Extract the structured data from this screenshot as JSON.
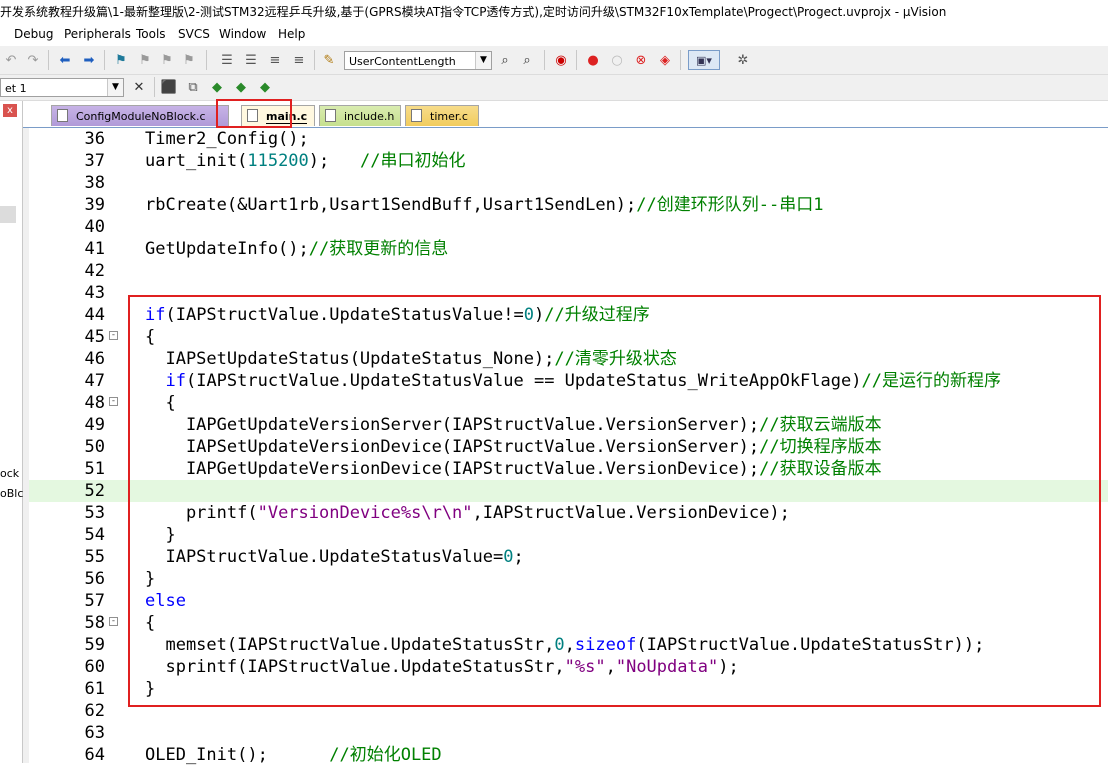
{
  "window": {
    "title": "开发系统教程升级篇\\1-最新整理版\\2-测试STM32远程乒乓升级,基于(GPRS模块AT指令TCP透传方式),定时访问升级\\STM32F10xTemplate\\Progect\\Progect.uvprojx - µVision"
  },
  "menu": [
    "Debug",
    "Peripherals",
    "Tools",
    "SVCS",
    "Window",
    "Help"
  ],
  "toolbar": {
    "find_combo_value": "UserContentLength",
    "target_combo_value": "et 1"
  },
  "left_panel": {
    "close_label": "x",
    "fragments": [
      "ock",
      "oBlc"
    ]
  },
  "tabs": [
    {
      "label": "ConfigModuleNoBlock.c",
      "active": false
    },
    {
      "label": "main.c",
      "active": true
    },
    {
      "label": "include.h",
      "active": false
    },
    {
      "label": "timer.c",
      "active": false
    }
  ],
  "code_lines": [
    {
      "num": "36",
      "fold": "",
      "tokens": [
        [
          "",
          "Timer2_Config();"
        ]
      ]
    },
    {
      "num": "37",
      "fold": "",
      "tokens": [
        [
          "",
          "uart_init("
        ],
        [
          "n",
          "115200"
        ],
        [
          "",
          ");   "
        ],
        [
          "c",
          "//串口初始化"
        ]
      ]
    },
    {
      "num": "38",
      "fold": "",
      "tokens": []
    },
    {
      "num": "39",
      "fold": "",
      "tokens": [
        [
          "",
          "rbCreate(&Uart1rb,Usart1SendBuff,Usart1SendLen);"
        ],
        [
          "c",
          "//创建环形队列--串口1"
        ]
      ]
    },
    {
      "num": "40",
      "fold": "",
      "tokens": []
    },
    {
      "num": "41",
      "fold": "",
      "tokens": [
        [
          "",
          "GetUpdateInfo();"
        ],
        [
          "c",
          "//获取更新的信息"
        ]
      ]
    },
    {
      "num": "42",
      "fold": "",
      "tokens": []
    },
    {
      "num": "43",
      "fold": "",
      "tokens": []
    },
    {
      "num": "44",
      "fold": "",
      "tokens": [
        [
          "k",
          "if"
        ],
        [
          "",
          "(IAPStructValue.UpdateStatusValue!="
        ],
        [
          "n",
          "0"
        ],
        [
          "",
          ")"
        ],
        [
          "c",
          "//升级过程序"
        ]
      ]
    },
    {
      "num": "45",
      "fold": "-",
      "tokens": [
        [
          "",
          "{"
        ]
      ]
    },
    {
      "num": "46",
      "fold": "",
      "tokens": [
        [
          "",
          "  IAPSetUpdateStatus(UpdateStatus_None);"
        ],
        [
          "c",
          "//清零升级状态"
        ]
      ]
    },
    {
      "num": "47",
      "fold": "",
      "tokens": [
        [
          "",
          "  "
        ],
        [
          "k",
          "if"
        ],
        [
          "",
          "(IAPStructValue.UpdateStatusValue == UpdateStatus_WriteAppOkFlage)"
        ],
        [
          "c",
          "//是运行的新程序"
        ]
      ]
    },
    {
      "num": "48",
      "fold": "-",
      "tokens": [
        [
          "",
          "  {"
        ]
      ]
    },
    {
      "num": "49",
      "fold": "",
      "tokens": [
        [
          "",
          "    IAPGetUpdateVersionServer(IAPStructValue.VersionServer);"
        ],
        [
          "c",
          "//获取云端版本"
        ]
      ]
    },
    {
      "num": "50",
      "fold": "",
      "tokens": [
        [
          "",
          "    IAPSetUpdateVersionDevice(IAPStructValue.VersionServer);"
        ],
        [
          "c",
          "//切换程序版本"
        ]
      ]
    },
    {
      "num": "51",
      "fold": "",
      "tokens": [
        [
          "",
          "    IAPGetUpdateVersionDevice(IAPStructValue.VersionDevice);"
        ],
        [
          "c",
          "//获取设备版本"
        ]
      ]
    },
    {
      "num": "52",
      "fold": "",
      "current": true,
      "tokens": []
    },
    {
      "num": "53",
      "fold": "",
      "tokens": [
        [
          "",
          "    printf("
        ],
        [
          "s",
          "\"VersionDevice%s\\r\\n\""
        ],
        [
          "",
          ",IAPStructValue.VersionDevice);"
        ]
      ]
    },
    {
      "num": "54",
      "fold": "",
      "tokens": [
        [
          "",
          "  }"
        ]
      ]
    },
    {
      "num": "55",
      "fold": "",
      "tokens": [
        [
          "",
          "  IAPStructValue.UpdateStatusValue="
        ],
        [
          "n",
          "0"
        ],
        [
          "",
          ";"
        ]
      ]
    },
    {
      "num": "56",
      "fold": "",
      "tokens": [
        [
          "",
          "}"
        ]
      ]
    },
    {
      "num": "57",
      "fold": "",
      "tokens": [
        [
          "k",
          "else"
        ]
      ]
    },
    {
      "num": "58",
      "fold": "-",
      "tokens": [
        [
          "",
          "{"
        ]
      ]
    },
    {
      "num": "59",
      "fold": "",
      "tokens": [
        [
          "",
          "  memset(IAPStructValue.UpdateStatusStr,"
        ],
        [
          "n",
          "0"
        ],
        [
          "",
          ","
        ],
        [
          "k",
          "sizeof"
        ],
        [
          "",
          "(IAPStructValue.UpdateStatusStr));"
        ]
      ]
    },
    {
      "num": "60",
      "fold": "",
      "tokens": [
        [
          "",
          "  sprintf(IAPStructValue.UpdateStatusStr,"
        ],
        [
          "s",
          "\"%s\""
        ],
        [
          "",
          ","
        ],
        [
          "s",
          "\"NoUpdata\""
        ],
        [
          "",
          ");"
        ]
      ]
    },
    {
      "num": "61",
      "fold": "",
      "tokens": [
        [
          "",
          "}"
        ]
      ]
    },
    {
      "num": "62",
      "fold": "",
      "tokens": []
    },
    {
      "num": "63",
      "fold": "",
      "tokens": []
    },
    {
      "num": "64",
      "fold": "",
      "tokens": [
        [
          "",
          "OLED_Init();      "
        ],
        [
          "c",
          "//初始化OLED"
        ]
      ]
    }
  ],
  "colors": {
    "keyword": "#0000ff",
    "number": "#008080",
    "comment": "#008000",
    "string": "#800080",
    "annotation": "#e02020"
  }
}
